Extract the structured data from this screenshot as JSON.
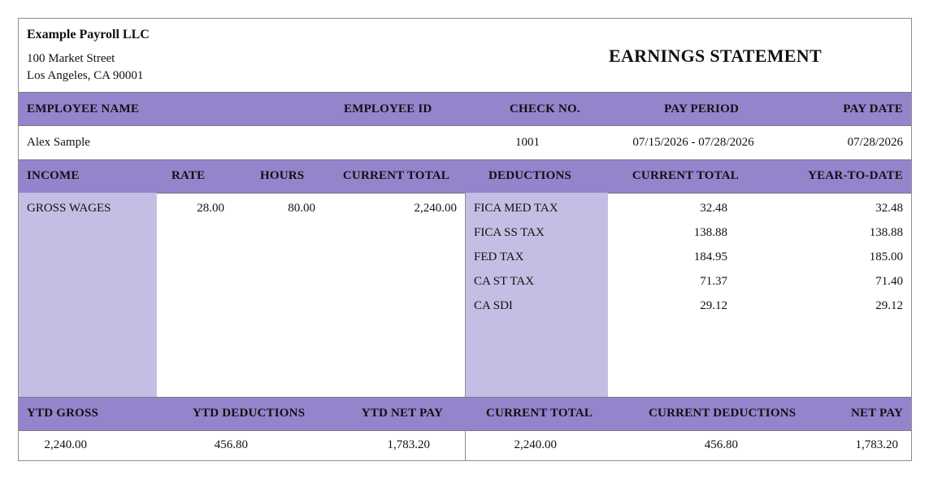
{
  "company": {
    "name": "Example Payroll LLC",
    "address_line1": "100 Market Street",
    "address_line2": "Los Angeles, CA 90001"
  },
  "statement_title": "EARNINGS STATEMENT",
  "employee_header": {
    "name": "EMPLOYEE NAME",
    "id": "EMPLOYEE ID",
    "check": "CHECK NO.",
    "period": "PAY PERIOD",
    "date": "PAY DATE"
  },
  "employee": {
    "name": "Alex Sample",
    "id": "",
    "check": "1001",
    "period": "07/15/2026 - 07/28/2026",
    "date": "07/28/2026"
  },
  "detail_header": {
    "income": "INCOME",
    "rate": "RATE",
    "hours": "HOURS",
    "income_current": "CURRENT TOTAL",
    "deductions": "DEDUCTIONS",
    "deductions_current": "CURRENT TOTAL",
    "ytd": "YEAR-TO-DATE"
  },
  "income": [
    {
      "label": "GROSS WAGES",
      "rate": "28.00",
      "hours": "80.00",
      "current": "2,240.00"
    }
  ],
  "deductions": [
    {
      "label": "FICA MED TAX",
      "current": "32.48",
      "ytd": "32.48"
    },
    {
      "label": "FICA SS TAX",
      "current": "138.88",
      "ytd": "138.88"
    },
    {
      "label": "FED TAX",
      "current": "184.95",
      "ytd": "185.00"
    },
    {
      "label": "CA ST TAX",
      "current": "71.37",
      "ytd": "71.40"
    },
    {
      "label": "CA SDI",
      "current": "29.12",
      "ytd": "29.12"
    }
  ],
  "summary_header": {
    "ytd_gross": "YTD GROSS",
    "ytd_deductions": "YTD DEDUCTIONS",
    "ytd_net": "YTD NET PAY",
    "current_total": "CURRENT TOTAL",
    "current_deductions": "CURRENT DEDUCTIONS",
    "net_pay": "NET PAY"
  },
  "summary": {
    "ytd_gross": "2,240.00",
    "ytd_deductions": "456.80",
    "ytd_net": "1,783.20",
    "current_total": "2,240.00",
    "current_deductions": "456.80",
    "net_pay": "1,783.20"
  },
  "colors": {
    "header_band": "#9384cc",
    "column_shade": "#c5bee4",
    "border": "#8d8d8d"
  }
}
